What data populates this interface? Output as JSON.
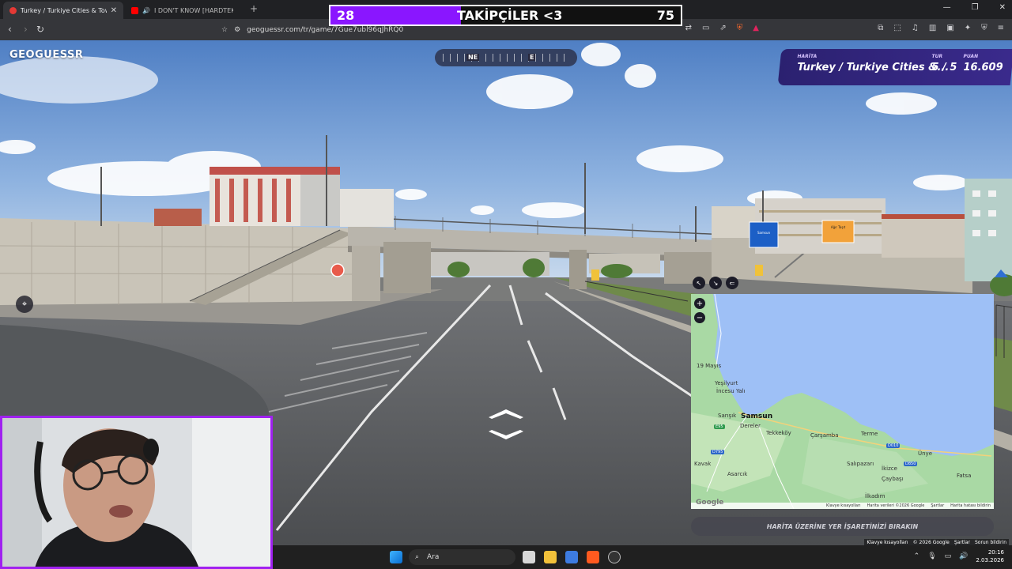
{
  "browser": {
    "tabs": [
      {
        "title": "Turkey / Turkiye Cities & Tow",
        "active": true
      },
      {
        "title": "I DON'T KNOW [HARDTEKK] - Yo",
        "active": false
      }
    ],
    "url": "geoguessr.com/tr/game/7Gue7ubl96qJhRQ0"
  },
  "stream_overlay": {
    "current": "28",
    "label": "TAKİPÇİLER <3",
    "goal": "75",
    "progress": 0.373
  },
  "game": {
    "logo": "GEOGUESSR",
    "compass": {
      "ne": "NE",
      "e": "E"
    },
    "hud": {
      "map_caption": "HARİTA",
      "map_value": "Turkey / Turkiye Cities &...",
      "round_caption": "TUR",
      "round_value": "5 / 5",
      "score_caption": "PUAN",
      "score_value": "16.609"
    },
    "guess_button": "HARİTA ÜZERİNE YER İŞARETİNİZİ BIRAKIN",
    "zoom_in": "+",
    "zoom_out": "−"
  },
  "map": {
    "places": [
      "19 Mayıs",
      "Yeşilyurt",
      "İncesu Yalı",
      "Samsun",
      "Sarışık",
      "Dereler",
      "Tekkeköy",
      "Çarşamba",
      "Terme",
      "Ünye",
      "Salıpazarı",
      "İkizce",
      "Çaybaşı",
      "Fatsa",
      "Kavak",
      "Asarcık",
      "İlkadım"
    ],
    "roads": [
      "E95",
      "D795",
      "D010",
      "D850"
    ],
    "footer": [
      "Klavye kısayolları",
      "Harita verileri ©2026 Google",
      "Şartlar",
      "Harita hatası bildirin"
    ],
    "google": "Google"
  },
  "streetview_footer": [
    "Klavye kısayolları",
    "© 2026 Google",
    "Şartlar",
    "Sorun bildirin"
  ],
  "signs": {
    "blue": "Samsun",
    "orange": "Ağır Taşıt"
  },
  "taskbar": {
    "search": "Ara",
    "time": "20:16",
    "date": "2.03.2026"
  }
}
